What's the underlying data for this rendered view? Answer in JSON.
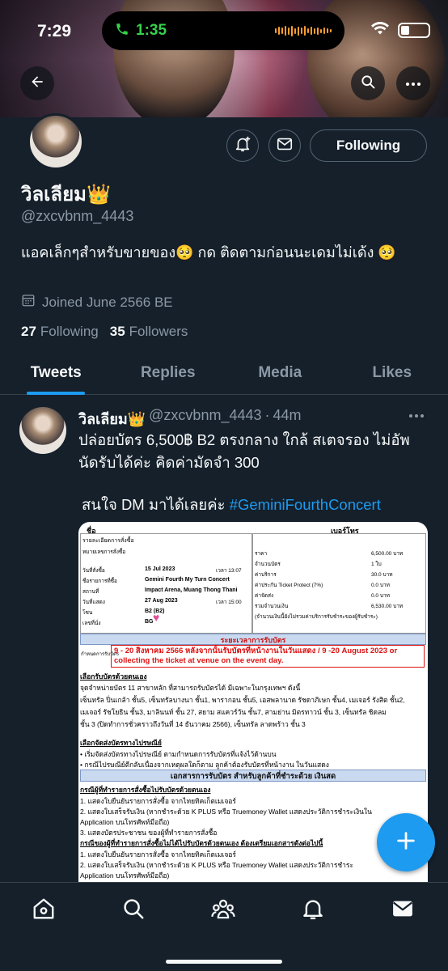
{
  "status_bar": {
    "time": "7:29",
    "call_time": "1:35"
  },
  "profile": {
    "display_name": "วิลเลียม👑",
    "handle": "@zxcvbnm_4443",
    "bio": "แอคเล็กๆสำหรับขายของ🥺 กด ติดตามก่อนนะเดมไม่เด้ง 🥺",
    "joined": "Joined June 2566 BE",
    "following_count": "27",
    "following_label": "Following",
    "followers_count": "35",
    "followers_label": "Followers",
    "follow_button": "Following"
  },
  "tabs": [
    {
      "label": "Tweets",
      "active": true
    },
    {
      "label": "Replies",
      "active": false
    },
    {
      "label": "Media",
      "active": false
    },
    {
      "label": "Likes",
      "active": false
    }
  ],
  "tweet": {
    "author": "วิลเลียม👑",
    "handle": "@zxcvbnm_4443",
    "sep": "·",
    "time": "44m",
    "line1": "ปล่อยบัตร 6,500฿ B2 ตรงกลาง ใกล้ สเตจรอง ไม่อัพ นัดรับได้ค่ะ คิดค่ามัดจำ 300",
    "line2_prefix": "สนใจ DM มาได้เลยค่ะ ",
    "hashtag": "#GeminiFourthConcert"
  },
  "ticket": {
    "top_left": "ชื่อ",
    "top_right": "เบอร์โทร",
    "order_label": "รายละเอียดการสั่งซื้อ",
    "rows_left": [
      {
        "k": "หมายเลขการสั่งซื้อ",
        "v": ""
      },
      {
        "k": "วันที่สั่งซื้อ",
        "v": "15 Jul 2023",
        "v2": "เวลา 13:07"
      },
      {
        "k": "ชื่อรายการที่ซื้อ",
        "v": "Gemini Fourth My Turn Concert"
      },
      {
        "k": "สถานที่",
        "v": "Impact Arena, Muang Thong Thani"
      },
      {
        "k": "วันที่แสดง",
        "v": "27 Aug 2023",
        "v2": "เวลา 15:00"
      },
      {
        "k": "โซน",
        "v": "B2 (B2)"
      },
      {
        "k": "เลขที่นั่ง",
        "v": "BG"
      }
    ],
    "rows_right": [
      {
        "k": "ราคา",
        "v": "6,500.00 บาท"
      },
      {
        "k": "จำนวนบัตร",
        "v": "1 ใบ"
      },
      {
        "k": "ค่าบริการ",
        "v": "30.0 บาท"
      },
      {
        "k": "ค่าประกัน Ticket Protect (7%)",
        "v": "0.0 บาท"
      },
      {
        "k": "ค่าจัดส่ง",
        "v": "0.0 บาท"
      },
      {
        "k": "รวมจำนวนเงิน",
        "v": "6,530.00 บาท"
      },
      {
        "k": "(จำนวนเงินนี้ยังไม่รวมค่าบริการรับชำระของผู้รับชำระ)",
        "v": ""
      }
    ],
    "period_title": "ระยะเวลาการรับบัตร",
    "period_label": "กำหนดการรับบัตร",
    "period_text": "9 - 20 สิงหาคม 2566 หลังจากนั้นรับบัตรที่หน้างานในวันแสดง / 9 -20 August 2023 or collecting the ticket at venue on the event day.",
    "self_pickup_title": "เลือกรับบัตรด้วยตนเอง",
    "self_pickup_lines": [
      "จุดจำหน่ายบัตร 11 สาขาหลัก ที่สามารถรับบัตรได้ มีเฉพาะในกรุงเทพฯ ดังนี้",
      "เซ็นทรัล ปิ่นเกล้า ชั้น5, เซ็นทรัลบางนา ชั้น1, พารากอน ชั้น5, เอสพลานาด รัชดาภิเษก ชั้น4, เมเจอร์ รังสิต ชั้น2,",
      "เมเจอร์ รัชโยธิน ชั้น3, มาลินนท์ ชั้น 27, สยาม สแควร์วัน ชั้น7, สามย่าน มิตรทาวน์ ชั้น 3, เซ็นทรัล ชิดลม",
      "ชั้น 3 (ปิดทำการชั่วคราวถึงวันที่ 14 ธันวาคม 2566), เซ็นทรัล ลาดพร้าว ชั้น 3"
    ],
    "post_title": "เลือกจัดส่งบัตรทางไปรษณีย์",
    "post_lines": [
      "• เริ่มจัดส่งบัตรทางไปรษณีย์ ตามกำหนดการรับบัตรที่แจ้งไว้ด้านบน",
      "• กรณีไปรษณีย์ตีกลับเนื่องจากเหตุผลใดก็ตาม ลูกค้าต้องรับบัตรที่หน้างาน ในวันแสดง"
    ],
    "docs_title": "เอกสารการรับบัตร สำหรับลูกค้าที่ชำระด้วย เงินสด",
    "case1_title": "กรณีผู้ที่ทำรายการสั่งซื้อไปรับบัตรด้วยตนเอง",
    "case1_lines": [
      "1. แสดงใบยืนยันรายการสั่งซื้อ จากไทยทิคเก็ตเมเจอร์",
      "2. แสดงใบเสร็จรับเงิน (หากชำระด้วย K PLUS หรือ Truemoney Wallet แสดงประวัติการชำระเงินใน",
      "Application บนโทรศัพท์มือถือ)",
      "3. แสดงบัตรประชาชน ของผู้ที่ทำรายการสั่งซื้อ"
    ],
    "case2_title": "กรณีของผู้ที่ทำรายการสั่งซื้อไม่ได้ไปรับบัตรด้วยตนเอง ต้องเตรียมเอกสารดังต่อไปนี้",
    "case2_lines": [
      "1. แสดงใบยืนยันรายการสั่งซื้อ จากไทยทิคเก็ตเมเจอร์",
      "2. แสดงใบเสร็จรับเงิน (หากชำระด้วย K PLUS หรือ Truemoney Wallet แสดงประวัติการชำระ",
      "Application บนโทรศัพท์มือถือ)"
    ]
  },
  "colors": {
    "accent": "#1d9bf0",
    "background": "#15202b",
    "muted": "#8b98a5"
  },
  "icons": [
    "back-arrow-icon",
    "search-icon",
    "more-icon",
    "bell-plus-icon",
    "mail-icon",
    "calendar-icon",
    "plus-icon",
    "home-icon",
    "communities-icon",
    "notifications-icon",
    "messages-icon"
  ]
}
